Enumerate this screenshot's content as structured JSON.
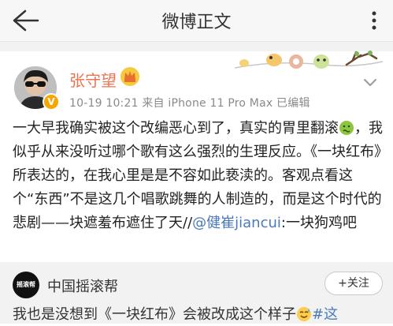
{
  "header": {
    "title": "微博正文",
    "back_icon": "arrow-left-icon",
    "more_icon": "more-dots-icon"
  },
  "post": {
    "username": "张守望",
    "badge_icon": "crown-membership-icon",
    "verified_icon": "verified-v-icon",
    "meta": "10-19 10:21  来自 iPhone 11 Pro Max  已编辑",
    "body_part1": "一大早我确实被这个改编恶心到了，真实的胃里翻滚",
    "body_part2": "，我似乎从来没听过哪个歌有这么强烈的生理反应。《一块红布》所表达的，在我心里是是不容如此亵渎的。客观点看这个“东西”不是这几个唱歌跳舞的人制造的，而是这个时代的悲剧——块遮羞布遮住了天//",
    "mention": "@健崔jiancui",
    "body_part3": ":一块狗鸡吧",
    "emoji_icon": "nauseated-face-icon"
  },
  "repost": {
    "account_name": "中国摇滚帮",
    "avatar_text": "摇滚帮",
    "follow_label": "+关注",
    "text": "我也是没想到《一块红布》会被改成这个样子",
    "emoji_icon": "sweat-smile-icon",
    "hashtag": "#这"
  },
  "colors": {
    "username": "#eb7350",
    "link": "#4a7ab8",
    "meta": "#8a8a8a",
    "badge": "#f7a600"
  }
}
